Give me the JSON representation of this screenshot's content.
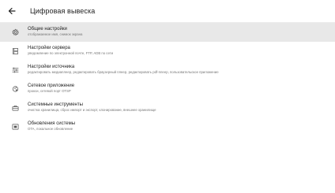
{
  "header": {
    "title": "Цифровая вывеска",
    "back_icon": "arrow-left-icon"
  },
  "settings": [
    {
      "id": "general",
      "icon": "gear-icon",
      "label": "Общие настройки",
      "desc": "отображаемое имя, снимок экрана",
      "selected": true
    },
    {
      "id": "server",
      "icon": "server-icon",
      "label": "Настройки сервера",
      "desc": "уведомление по электронной почте, FTP, ADB по сети",
      "selected": false
    },
    {
      "id": "source",
      "icon": "sliders-icon",
      "label": "Настройки источника",
      "desc": "редактировать медиаплеер, редактировать браузерный плеер, редактировать pdf-плеер, пользовательское приложение",
      "selected": false
    },
    {
      "id": "network",
      "icon": "network-icon",
      "label": "Сетевое приложение",
      "desc": "прокси, сетевой порт OTSP",
      "selected": false
    },
    {
      "id": "system-tools",
      "icon": "toolbox-icon",
      "label": "Системные инструменты",
      "desc": "очистка хранилища, сброс импорт и экспорт, клонирование, внешнее хранилище",
      "selected": false
    },
    {
      "id": "updates",
      "icon": "update-icon",
      "label": "Обновления системы",
      "desc": "OTA, локальное обновление",
      "selected": false
    }
  ],
  "colors": {
    "selected_bg": "#e8e8e8",
    "text_primary": "#222222",
    "text_secondary": "#777777",
    "icon": "#555555"
  }
}
